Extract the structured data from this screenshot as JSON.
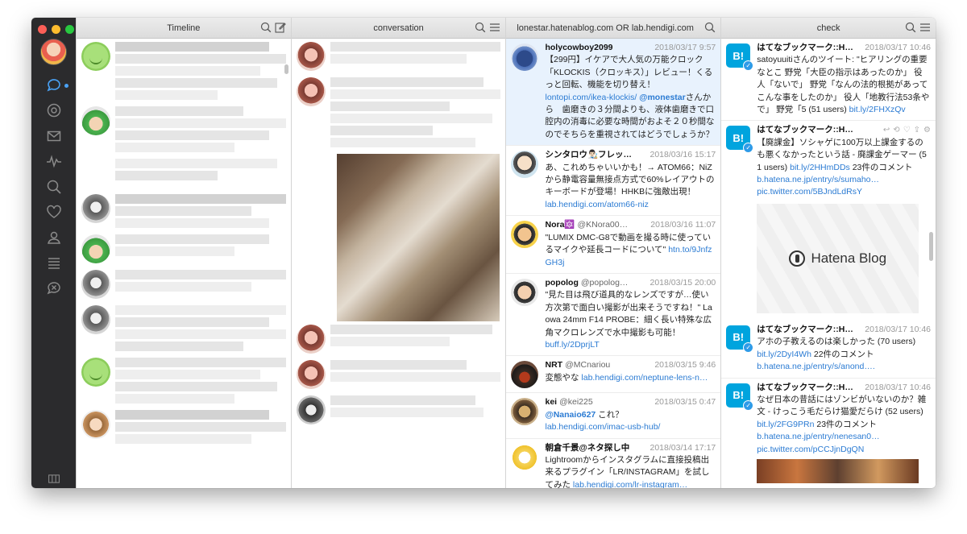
{
  "window": {
    "columns": [
      {
        "title": "Timeline"
      },
      {
        "title": "conversation"
      },
      {
        "title": "lonestar.hatenablog.com OR lab.hendigi.com OR"
      },
      {
        "title": "check"
      }
    ]
  },
  "search_tweets": [
    {
      "name": "holycowboy2099",
      "handle": "",
      "time": "2018/03/17 9:57",
      "text": "【299円】イケアで大人気の万能クロック「KLOCKIS（クロッキス）」レビュー！くるっと回転、機能を切り替え！",
      "link1": "lontopi.com/ikea-klockis/",
      "mention": "@monestar",
      "text2": "さんから　歯磨きの３分間よりも、液体歯磨きで口腔内の消毒に必要な時間がおよそ２０秒間なのでそちらを重視されてはどうでしょうか？"
    },
    {
      "name": "シンタロウ👨🏻‍🎨フレッ…",
      "handle": "",
      "time": "2018/03/16 15:17",
      "text": "あ、これめちゃいいかも！→ ATOM66：NiZから静電容量無接点方式で60%レイアウトのキーボードが登場！HHKBに強敵出現！",
      "link1": "lab.hendigi.com/atom66-niz"
    },
    {
      "name": "Nora🔯",
      "handle": "@KNora00…",
      "time": "2018/03/16 11:07",
      "text": "\"LUMIX DMC-G8で動画を撮る時に使っているマイクや延長コードについて\"",
      "link1": "htn.to/9JnfzGH3j"
    },
    {
      "name": "popolog",
      "handle": "@popolog…",
      "time": "2018/03/15 20:00",
      "text": "\"見た目は飛び道具的なレンズですが…使い方次第で面白い撮影が出来そうですね！\" Laowa 24mm F14 PROBE：細く長い特殊な広角マクロレンズで水中撮影も可能！",
      "link1": "buff.ly/2DprjLT"
    },
    {
      "name": "NRT",
      "handle": "@MCnariou",
      "time": "2018/03/15 9:46",
      "text": "変態やな",
      "link1": "lab.hendigi.com/neptune-lens-n…"
    },
    {
      "name": "kei",
      "handle": "@kei225",
      "time": "2018/03/15 0:47",
      "mention": "@Nanaio627",
      "text": "これ？",
      "link1": "lab.hendigi.com/imac-usb-hub/"
    },
    {
      "name": "朝倉千景@ネタ探し中",
      "handle": "",
      "time": "2018/03/14 17:17",
      "text": "Lightroomからインスタグラムに直接投稿出来るプラグイン「LR/INSTAGRAM」を試してみた",
      "link1": "lab.hendigi.com/lr-instagram…"
    }
  ],
  "check_tweets": [
    {
      "name": "はてなブックマーク::H…",
      "time": "2018/03/17 10:46",
      "text": "satoyuuitiさんのツイート: \"ヒアリングの重要なとこ 野党「大臣の指示はあったのか」 役人「ないで」 野党「なんの法的根拠があってこんな事をしたのか」 役人「地教行法53条やで」 野党「5 (51 users)",
      "link1": "bit.ly/2FHXzQv"
    },
    {
      "name": "はてなブックマーク::H…",
      "time": "",
      "text": "【廃課金】ソシャゲに100万以上課金するのも悪くなかったという話 - 廃課金ゲーマー (51 users)",
      "link1": "bit.ly/2HHmDDs",
      "text2": "23件のコメント",
      "link2": "b.hatena.ne.jp/entry/s/sumaho…",
      "link3": "pic.twitter.com/5BJndLdRsY",
      "card_title": "Hatena Blog"
    },
    {
      "name": "はてなブックマーク::H…",
      "time": "2018/03/17 10:46",
      "text": "アホの子教えるのは楽しかった (70 users)",
      "link1": "bit.ly/2DyI4Wh",
      "text2": "22件のコメント",
      "link2": "b.hatena.ne.jp/entry/s/anond…."
    },
    {
      "name": "はてなブックマーク::H…",
      "time": "2018/03/17 10:46",
      "text": "なぜ日本の昔話にはゾンビがいないのか？雑文 - けっこう毛だらけ猫愛だらけ (52 users)",
      "link1": "bit.ly/2FG9PRn",
      "text2": "23件のコメント",
      "link2": "b.hatena.ne.jp/entry/nenesan0…",
      "link3": "pic.twitter.com/pCCJjnDgQN"
    }
  ],
  "hatena_logo": "B!"
}
